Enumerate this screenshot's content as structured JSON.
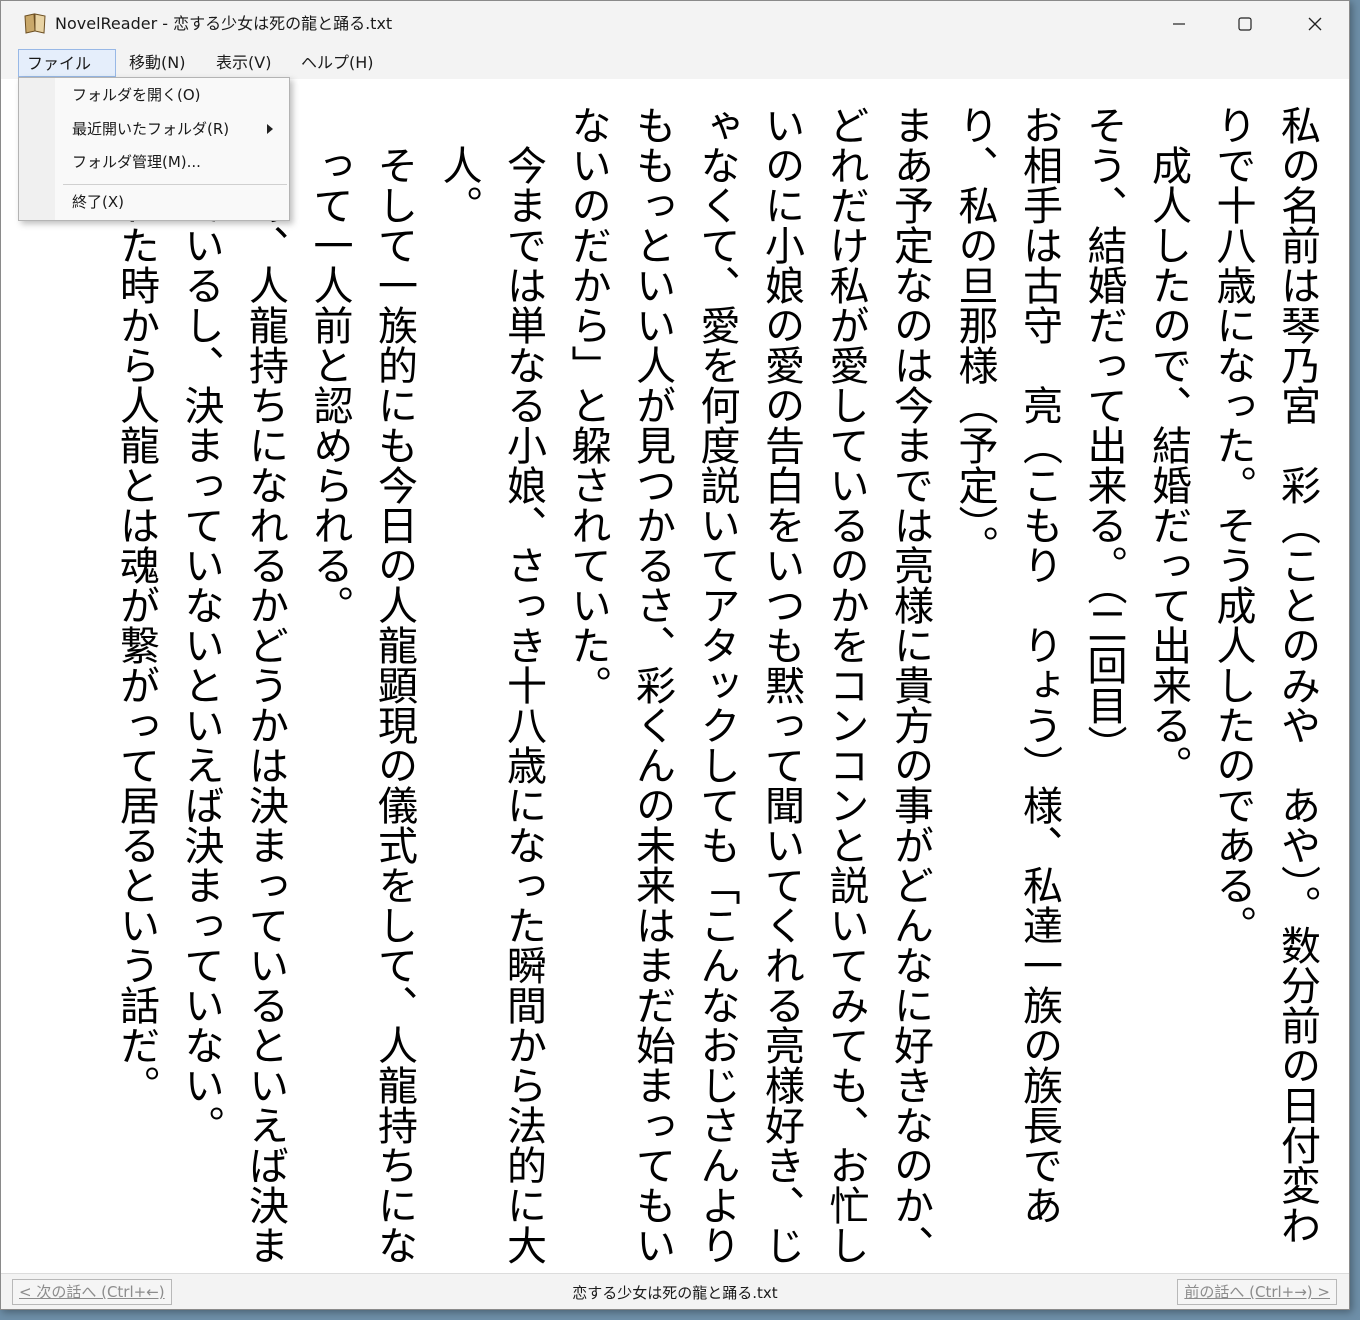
{
  "window": {
    "title": "NovelReader - 恋する少女は死の龍と踊る.txt",
    "controls": [
      "minimize",
      "maximize",
      "close"
    ]
  },
  "menubar": {
    "items": [
      {
        "label": "ファイル(F)"
      },
      {
        "label": "移動(N)"
      },
      {
        "label": "表示(V)"
      },
      {
        "label": "ヘルプ(H)"
      }
    ]
  },
  "file_menu": {
    "open_folder": "フォルダを開く(O)",
    "recent_folders": "最近開いたフォルダ(R)",
    "manage_folders": "フォルダ管理(M)...",
    "exit": "終了(X)"
  },
  "content": {
    "paragraphs": [
      "私の名前は琴乃宮　彩（ことのみや　あや）。数分前の日付変わりで十八歳になった。そう成人したのである。",
      "成人したので、結婚だって出来る。",
      "そう、結婚だって出来る。（二回目）",
      "お相手は古守　亮（こもり　りょう）様、私達一族の族長であり、私の旦那様（予定）。",
      "まあ予定なのは今までは亮様に貴方の事がどんなに好きなのか、どれだけ私が愛しているのかをコンコンと説いてみても、お忙しいのに小娘の愛の告白をいつも黙って聞いてくれる亮様好き、じゃなくて、愛を何度説いてアタックしても「こんなおじさんよりももっといい人が見つかるさ、彩くんの未来はまだ始まってもいないのだから」と躱されていた。",
      "今までは単なる小娘、さっき十八歳になった瞬間から法的に大人。",
      "そして一族的にも今日の人龍顕現の儀式をして、人龍持ちになって一人前と認められる。",
      "まあ、人龍持ちになれるかどうかは決まっているといえば決まっているし、決まっていないといえば決まっていない。",
      "生まれた時から人龍とは魂が繋がって居るという話だ。"
    ]
  },
  "statusbar": {
    "next_button": "< 次の話へ (Ctrl+←)",
    "file_name": "恋する少女は死の龍と踊る.txt",
    "prev_button": "前の話へ (Ctrl+→) >"
  }
}
